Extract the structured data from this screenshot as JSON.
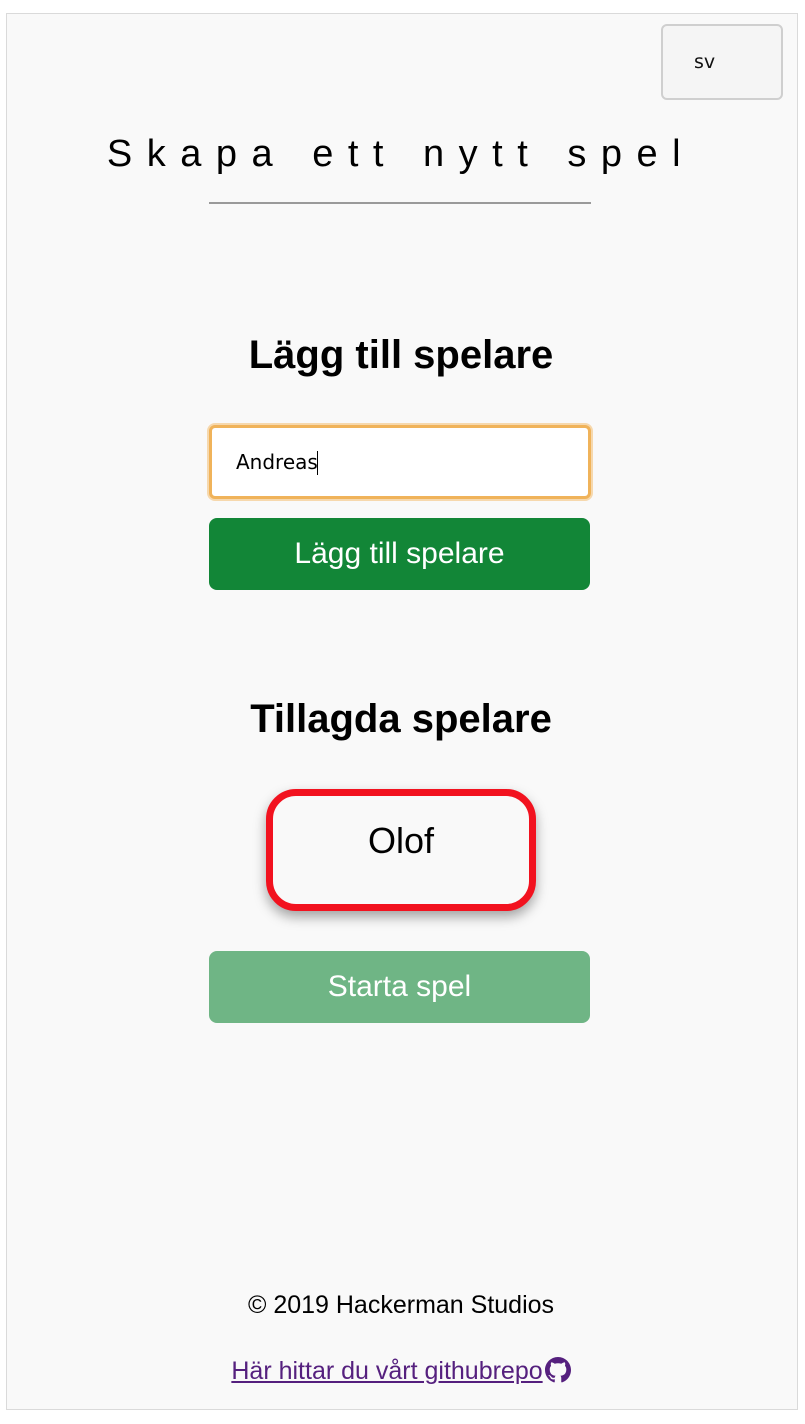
{
  "language": {
    "selected": "sv"
  },
  "page": {
    "title": "Skapa ett nytt spel"
  },
  "add_player": {
    "heading": "Lägg till spelare",
    "input_value": "Andreas",
    "button_label": "Lägg till spelare"
  },
  "added_players": {
    "heading": "Tillagda spelare",
    "players": [
      "Olof"
    ]
  },
  "start": {
    "button_label": "Starta spel"
  },
  "footer": {
    "copyright": "© 2019 Hackerman Studios",
    "link_text": "Här hittar du vårt githubrepo",
    "link_icon": "github-icon"
  },
  "colors": {
    "primary_green": "#128637",
    "disabled_green": "#6fb585",
    "highlight_red": "#f2121f",
    "input_focus": "#f0b35a",
    "link_purple": "#55207e"
  }
}
